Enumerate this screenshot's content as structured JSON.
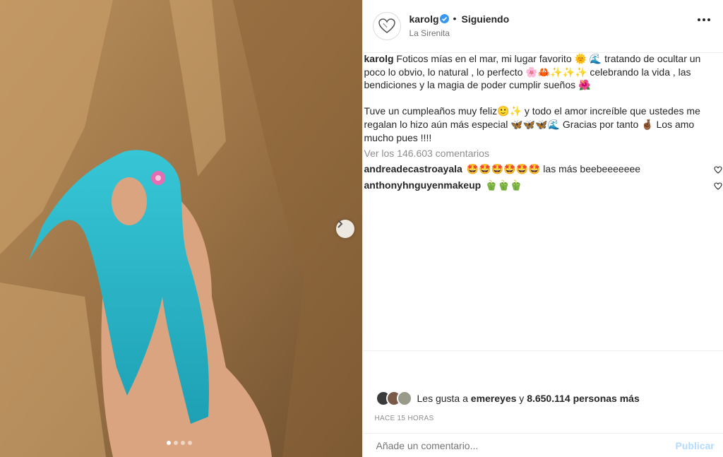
{
  "header": {
    "username": "karolg",
    "separator": "•",
    "follow_status": "Siguiendo",
    "location": "La Sirenita",
    "avatar_icon": "heart-outline-icon",
    "verified_icon": "verified-badge-icon",
    "more_icon": "more-options-icon"
  },
  "caption": {
    "author": "karolg",
    "paragraph1": "Foticos mías en el mar, mi lugar favorito 🌞 🌊 tratando de ocultar un poco lo obvio, lo natural , lo perfecto 🌸🦀✨✨✨ celebrando la vida , las bendiciones y la magia de poder cumplir sueños 🌺",
    "paragraph2": "Tuve un cumpleaños muy feliz🙂✨ y todo el amor increíble que ustedes me regalan lo hizo aún más especial 🦋🦋🦋🌊 Gracias por tanto 🤞🏾 Los amo mucho pues !!!!"
  },
  "comments": {
    "view_all": "Ver los 146.603 comentarios",
    "items": [
      {
        "user": "andreadecastroayala",
        "text": "🤩🤩🤩🤩🤩🤩 las más beebeeeeeee"
      },
      {
        "user": "anthonyhnguyenmakeup",
        "text": "🫑🫑🫑"
      }
    ]
  },
  "likes": {
    "prefix": "Les gusta a",
    "user": "emereyes",
    "connector": "y",
    "count_text": "8.650.114 personas más"
  },
  "timestamp": "HACE 15 HORAS",
  "add_comment": {
    "placeholder": "Añade un comentario...",
    "publish_label": "Publicar"
  },
  "media": {
    "carousel_total": 4,
    "carousel_active": 1,
    "next_icon": "chevron-right-icon"
  },
  "colors": {
    "link_disabled": "#b3dbff",
    "verified": "#3897f0",
    "secondary_text": "#8e8e8e"
  }
}
